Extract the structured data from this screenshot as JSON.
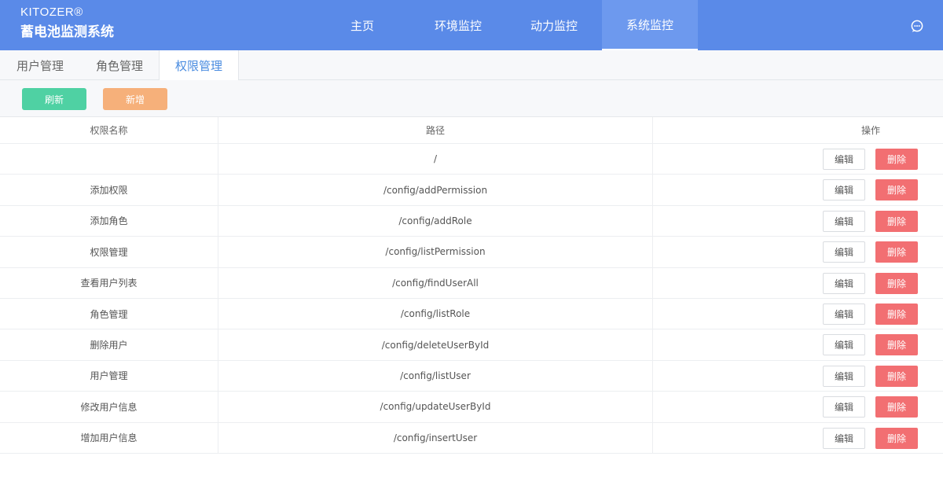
{
  "header": {
    "brand_top": "KITOZER®",
    "brand_main": "蓄电池监测系统",
    "nav": [
      "主页",
      "环境监控",
      "动力监控",
      "系统监控"
    ],
    "active_nav": 3,
    "chat_icon": "chat-bubble-icon"
  },
  "tabs": [
    "用户管理",
    "角色管理",
    "权限管理"
  ],
  "toolbar": {
    "refresh_label": "刷新",
    "add_label": "新增"
  },
  "table": {
    "columns": [
      "权限名称",
      "路径",
      "操作"
    ],
    "edit_label": "编辑",
    "delete_label": "删除",
    "rows": [
      {
        "name": "",
        "path": "/"
      },
      {
        "name": "添加权限",
        "path": "/config/addPermission"
      },
      {
        "name": "添加角色",
        "path": "/config/addRole"
      },
      {
        "name": "权限管理",
        "path": "/config/listPermission"
      },
      {
        "name": "查看用户列表",
        "path": "/config/findUserAll"
      },
      {
        "name": "角色管理",
        "path": "/config/listRole"
      },
      {
        "name": "删除用户",
        "path": "/config/deleteUserById"
      },
      {
        "name": "用户管理",
        "path": "/config/listUser"
      },
      {
        "name": "修改用户信息",
        "path": "/config/updateUserById"
      },
      {
        "name": "增加用户信息",
        "path": "/config/insertUser"
      }
    ]
  },
  "colors": {
    "header": "#5a8ae8",
    "refresh": "#4fd1a3",
    "add": "#f6b07a",
    "delete": "#f26f72",
    "active_tab": "#4a8ce0"
  }
}
